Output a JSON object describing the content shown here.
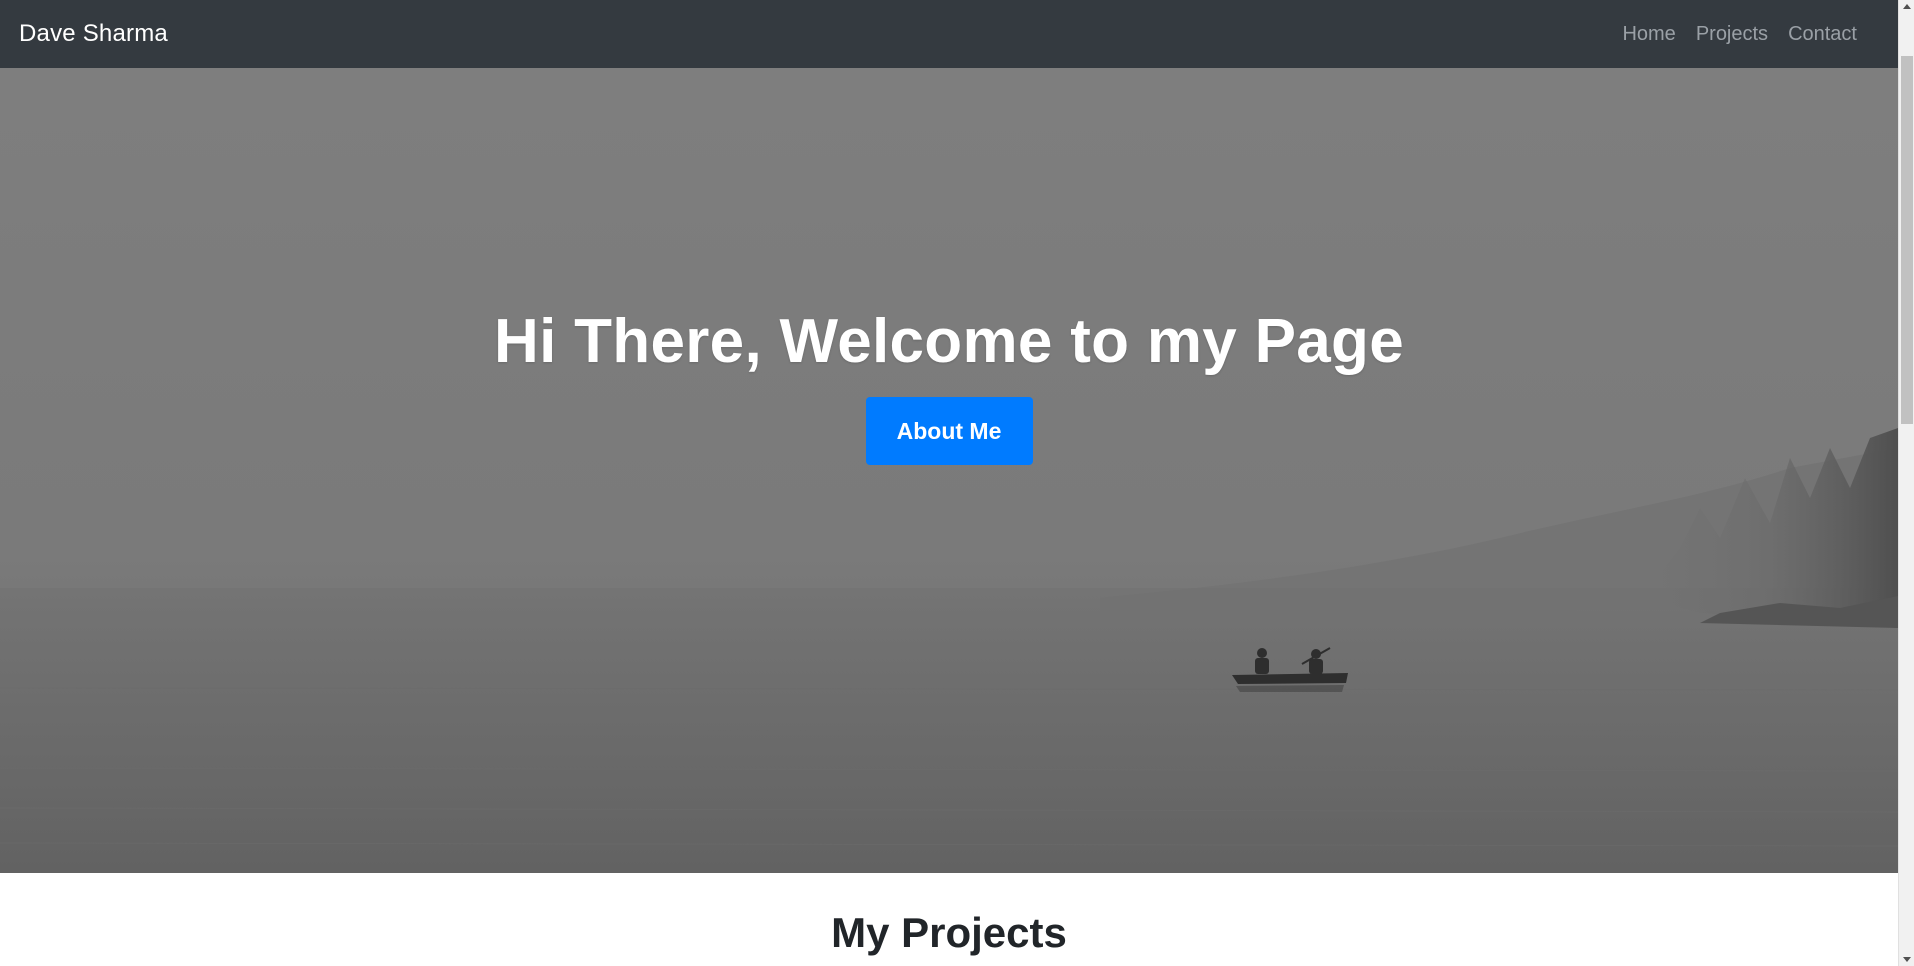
{
  "navbar": {
    "brand": "Dave Sharma",
    "links": [
      "Home",
      "Projects",
      "Contact"
    ]
  },
  "hero": {
    "title": "Hi There, Welcome to my Page",
    "button_label": "About Me"
  },
  "projects": {
    "title": "My Projects"
  },
  "colors": {
    "navbar_bg": "#343a40",
    "button_bg": "#007bff",
    "hero_overlay": "#7a7a7a"
  }
}
